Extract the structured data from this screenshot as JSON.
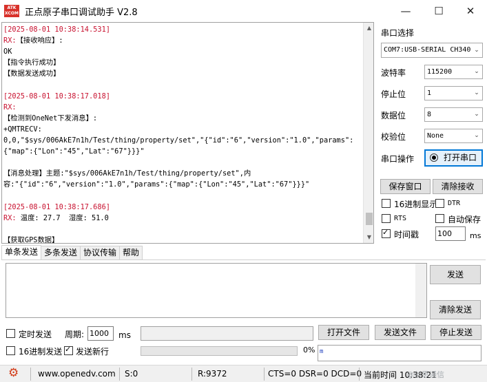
{
  "window": {
    "logo_text": "ATK\nXCOM",
    "title": "正点原子串口调试助手 V2.8",
    "minimize_glyph": "—",
    "maximize_glyph": "☐",
    "close_glyph": "✕"
  },
  "receive": {
    "lines": [
      {
        "text": "[2025-08-01 10:38:14.531]",
        "kind": "ts"
      },
      {
        "text": "RX:【接收响应】:",
        "kind": "rx"
      },
      {
        "text": "OK",
        "kind": "plain"
      },
      {
        "text": "【指令执行成功】",
        "kind": "plain"
      },
      {
        "text": "【数据发送成功】",
        "kind": "plain"
      },
      {
        "text": "",
        "kind": "plain"
      },
      {
        "text": "[2025-08-01 10:38:17.018]",
        "kind": "ts"
      },
      {
        "text": "RX:",
        "kind": "rx"
      },
      {
        "text": "【检测到OneNet下发消息】:",
        "kind": "plain"
      },
      {
        "text": "+QMTRECV:",
        "kind": "plain"
      },
      {
        "text": "0,0,\"$sys/006AkE7n1h/Test/thing/property/set\",\"{\"id\":\"6\",\"version\":\"1.0\",\"params\":",
        "kind": "plain"
      },
      {
        "text": "{\"map\":{\"Lon\":\"45\",\"Lat\":\"67\"}}}\"",
        "kind": "plain"
      },
      {
        "text": "",
        "kind": "plain"
      },
      {
        "text": "【消息处理】主题:\"$sys/006AkE7n1h/Test/thing/property/set\",内",
        "kind": "plain"
      },
      {
        "text": "容:\"{\"id\":\"6\",\"version\":\"1.0\",\"params\":{\"map\":{\"Lon\":\"45\",\"Lat\":\"67\"}}}\"",
        "kind": "plain"
      },
      {
        "text": "",
        "kind": "plain"
      },
      {
        "text": "[2025-08-01 10:38:17.686]",
        "kind": "ts"
      },
      {
        "text": "RX: 温度: 27.7  湿度: 51.0",
        "kind": "rx"
      },
      {
        "text": "",
        "kind": "plain"
      },
      {
        "text": "【获取GPS数据】",
        "kind": "plain"
      }
    ]
  },
  "settings": {
    "port_select_label": "串口选择",
    "port_value": "COM7:USB-SERIAL CH340",
    "baud_label": "波特率",
    "baud_value": "115200",
    "stopbits_label": "停止位",
    "stopbits_value": "1",
    "databits_label": "数据位",
    "databits_value": "8",
    "parity_label": "校验位",
    "parity_value": "None",
    "port_op_label": "串口操作",
    "open_port_button": "打开串口",
    "save_window_button": "保存窗口",
    "clear_recv_button": "清除接收",
    "hex_display_label": "16进制显示",
    "hex_display_checked": false,
    "dtr_label": "DTR",
    "dtr_checked": false,
    "rts_label": "RTS",
    "rts_checked": false,
    "auto_save_label": "自动保存",
    "auto_save_checked": false,
    "timestamp_label": "时间戳",
    "timestamp_checked": true,
    "timestamp_interval": "100",
    "timestamp_unit": "ms"
  },
  "tabs": [
    "单条发送",
    "多条发送",
    "协议传输",
    "帮助"
  ],
  "send": {
    "send_button": "发送",
    "clear_send_button": "清除发送",
    "timed_send_label": "定时发送",
    "timed_send_checked": false,
    "period_label": "周期:",
    "period_value": "1000",
    "period_unit": "ms",
    "open_file_button": "打开文件",
    "send_file_button": "发送文件",
    "stop_send_button": "停止发送",
    "hex_send_label": "16进制发送",
    "hex_send_checked": false,
    "newline_label": "发送新行",
    "newline_checked": true,
    "progress_text": "0%",
    "progress_fraction": 0,
    "url_box_text": "m"
  },
  "status": {
    "website": "www.openedv.com",
    "sent": "S:0",
    "received": "R:9372",
    "lines": "CTS=0 DSR=0 DCD=0",
    "time": "当前时间 10:38:21",
    "watermark": "@创思通信"
  }
}
